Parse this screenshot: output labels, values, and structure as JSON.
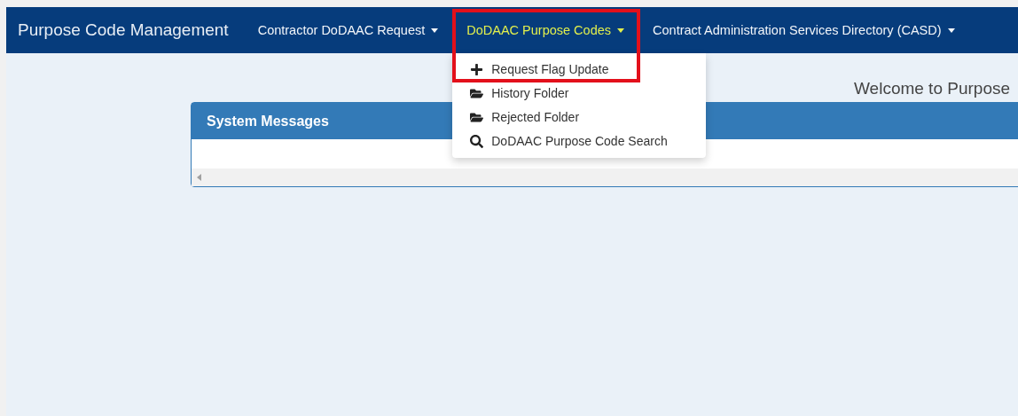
{
  "navbar": {
    "brand": "Purpose Code Management",
    "items": [
      {
        "label": "Contractor DoDAAC Request",
        "selected": false
      },
      {
        "label": "DoDAAC Purpose Codes",
        "selected": true,
        "menu": [
          {
            "kind": "add",
            "label": "Request Flag Update"
          },
          {
            "kind": "folder",
            "label": "History Folder"
          },
          {
            "kind": "folder",
            "label": "Rejected Folder"
          },
          {
            "kind": "search",
            "label": "DoDAAC Purpose Code Search"
          }
        ]
      },
      {
        "label": "Contract Administration Services Directory (CASD)",
        "selected": false
      }
    ]
  },
  "annotation": {
    "kind": "highlight_box"
  },
  "welcome": "Welcome to Purpose",
  "panel": {
    "title": "System Messages"
  }
}
